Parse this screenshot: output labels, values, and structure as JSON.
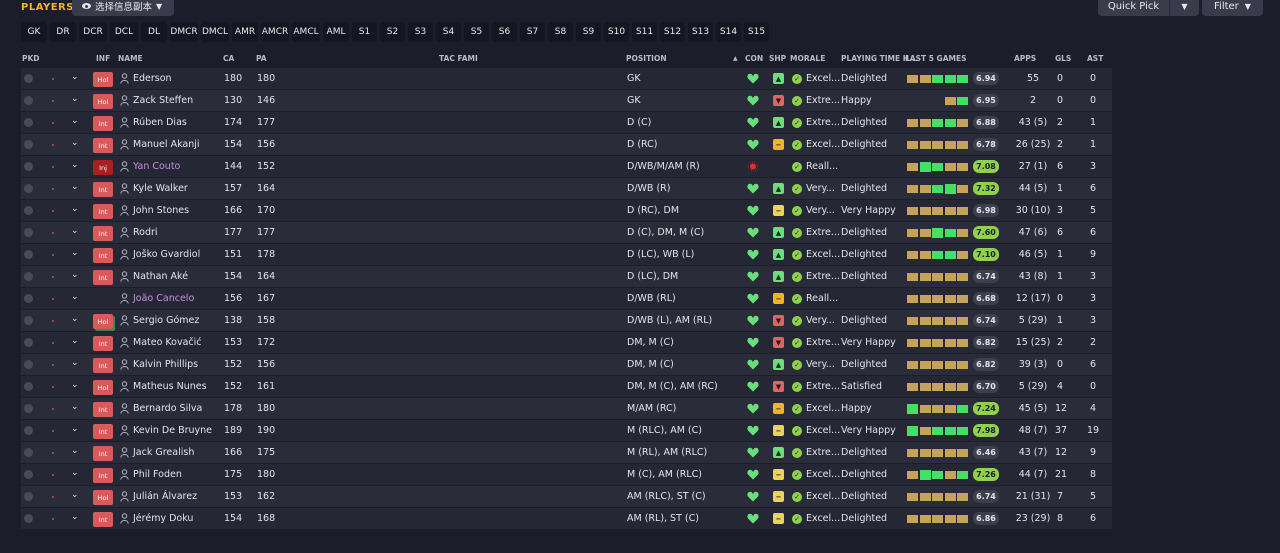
{
  "header": {
    "title": "PLAYERS",
    "view_label": "选择信息副本",
    "quick_pick_label": "Quick Pick",
    "filter_label": "Filter"
  },
  "positions": [
    "GK",
    "DR",
    "DCR",
    "DCL",
    "DL",
    "DMCR",
    "DMCL",
    "AMR",
    "AMCR",
    "AMCL",
    "AML",
    "S1",
    "S2",
    "S3",
    "S4",
    "S5",
    "S6",
    "S7",
    "S8",
    "S9",
    "S10",
    "S11",
    "S12",
    "S13",
    "S14",
    "S15"
  ],
  "columns": {
    "pkd": "PKD",
    "inf": "INF",
    "name": "NAME",
    "ca": "CA",
    "pa": "PA",
    "tac": "TAC FAMI",
    "position": "POSITION",
    "con": "CON",
    "shp": "SHP",
    "morale": "MORALE",
    "playing_time": "PLAYING TIME H...",
    "last5": "LAST 5 GAMES",
    "apps": "APPS",
    "gls": "GLS",
    "ast": "AST"
  },
  "colors": {
    "accent": "#f0b428",
    "green": "#68e07a",
    "yellow": "#e8d45a",
    "red": "#e06464",
    "orange": "#f0b428",
    "morale_green": "#8fd14f",
    "form_yellow": "#c5a35a",
    "form_green": "#44e066"
  },
  "players": [
    {
      "inf": "Hol",
      "name": "Ederson",
      "ca": "180",
      "pa": "180",
      "position": "GK",
      "con": "heart",
      "shp": "up",
      "shp_color": "green",
      "morale": "Excel...",
      "playing_time": "Delighted",
      "form": "yyggg",
      "rating": "6.94",
      "rating_style": "grey",
      "apps": "55",
      "gls": "0",
      "ast": "0"
    },
    {
      "inf": "Hol",
      "name": "Zack Steffen",
      "ca": "130",
      "pa": "146",
      "position": "GK",
      "con": "heart",
      "shp": "down",
      "shp_color": "red",
      "morale": "Extre...",
      "playing_time": "Happy",
      "form": "   yg",
      "rating": "6.95",
      "rating_style": "grey",
      "apps": "2",
      "gls": "0",
      "ast": "0"
    },
    {
      "inf": "Int",
      "name": "Rúben Dias",
      "ca": "174",
      "pa": "177",
      "position": "D (C)",
      "con": "heart",
      "shp": "up",
      "shp_color": "green",
      "morale": "Extre...",
      "playing_time": "Delighted",
      "form": "yyggy",
      "rating": "6.88",
      "rating_style": "grey",
      "apps": "43 (5)",
      "gls": "2",
      "ast": "1"
    },
    {
      "inf": "Int",
      "name": "Manuel Akanji",
      "ca": "154",
      "pa": "156",
      "position": "D (RC)",
      "con": "heart",
      "shp": "flat",
      "shp_color": "orange",
      "morale": "Excel...",
      "playing_time": "Delighted",
      "form": "yyyyy",
      "rating": "6.78",
      "rating_style": "grey",
      "apps": "26 (25)",
      "gls": "2",
      "ast": "1"
    },
    {
      "inf": "Inj",
      "name": "Yan Couto",
      "ca": "144",
      "pa": "152",
      "position": "D/WB/M/AM (R)",
      "con": "injury",
      "shp": "",
      "shp_color": "",
      "morale": "Reall...",
      "playing_time": "",
      "form": "yGgyy",
      "rating": "7.08",
      "rating_style": "green",
      "apps": "27 (1)",
      "gls": "6",
      "ast": "3"
    },
    {
      "inf": "Int",
      "name": "Kyle Walker",
      "ca": "157",
      "pa": "164",
      "position": "D/WB (R)",
      "con": "heart",
      "shp": "up",
      "shp_color": "green",
      "morale": "Very...",
      "playing_time": "Delighted",
      "form": "yygGy",
      "rating": "7.32",
      "rating_style": "green",
      "apps": "44 (5)",
      "gls": "1",
      "ast": "6"
    },
    {
      "inf": "Int",
      "name": "John Stones",
      "ca": "166",
      "pa": "170",
      "position": "D (RC), DM",
      "con": "heart",
      "shp": "flat",
      "shp_color": "yellow",
      "morale": "Very...",
      "playing_time": "Very Happy",
      "form": "yyyyy",
      "rating": "6.98",
      "rating_style": "grey",
      "apps": "30 (10)",
      "gls": "3",
      "ast": "5"
    },
    {
      "inf": "Int",
      "name": "Rodri",
      "ca": "177",
      "pa": "177",
      "position": "D (C), DM, M (C)",
      "con": "heart",
      "shp": "up",
      "shp_color": "green",
      "morale": "Extre...",
      "playing_time": "Delighted",
      "form": "yyGgy",
      "rating": "7.60",
      "rating_style": "green",
      "apps": "47 (6)",
      "gls": "6",
      "ast": "6"
    },
    {
      "inf": "Int",
      "name": "Joško Gvardiol",
      "ca": "151",
      "pa": "178",
      "position": "D (LC), WB (L)",
      "con": "heart",
      "shp": "up",
      "shp_color": "green",
      "morale": "Excel...",
      "playing_time": "Delighted",
      "form": "yyggy",
      "rating": "7.10",
      "rating_style": "green",
      "apps": "46 (5)",
      "gls": "1",
      "ast": "9"
    },
    {
      "inf": "Int",
      "name": "Nathan Aké",
      "ca": "154",
      "pa": "164",
      "position": "D (LC), DM",
      "con": "heart",
      "shp": "up",
      "shp_color": "green",
      "morale": "Extre...",
      "playing_time": "Delighted",
      "form": "yyyyy",
      "rating": "6.74",
      "rating_style": "grey",
      "apps": "43 (8)",
      "gls": "1",
      "ast": "3"
    },
    {
      "inf": "",
      "name": "João Cancelo",
      "ca": "156",
      "pa": "167",
      "position": "D/WB (RL)",
      "con": "heart",
      "shp": "flat",
      "shp_color": "orange",
      "morale": "Reall...",
      "playing_time": "",
      "form": "yyyyy",
      "rating": "6.68",
      "rating_style": "grey",
      "apps": "12 (17)",
      "gls": "0",
      "ast": "3"
    },
    {
      "inf": "Hol",
      "name": "Sergio Gómez",
      "ca": "138",
      "pa": "158",
      "position": "D/WB (L), AM (RL)",
      "con": "heart",
      "shp": "down",
      "shp_color": "red",
      "morale": "Very...",
      "playing_time": "Delighted",
      "form": "yyyyy",
      "rating": "6.74",
      "rating_style": "grey",
      "apps": "5 (29)",
      "gls": "1",
      "ast": "3"
    },
    {
      "inf": "Int",
      "name": "Mateo Kovačić",
      "ca": "153",
      "pa": "172",
      "position": "DM, M (C)",
      "con": "heart",
      "shp": "down",
      "shp_color": "red",
      "morale": "Extre...",
      "playing_time": "Very Happy",
      "form": "yyyyy",
      "rating": "6.82",
      "rating_style": "grey",
      "apps": "15 (25)",
      "gls": "2",
      "ast": "2"
    },
    {
      "inf": "Int",
      "name": "Kalvin Phillips",
      "ca": "152",
      "pa": "156",
      "position": "DM, M (C)",
      "con": "heart",
      "shp": "up",
      "shp_color": "green",
      "morale": "Very...",
      "playing_time": "Delighted",
      "form": "yyyyy",
      "rating": "6.82",
      "rating_style": "grey",
      "apps": "39 (3)",
      "gls": "0",
      "ast": "6"
    },
    {
      "inf": "Hol",
      "name": "Matheus Nunes",
      "ca": "152",
      "pa": "161",
      "position": "DM, M (C), AM (RC)",
      "con": "heart",
      "shp": "down",
      "shp_color": "red",
      "morale": "Extre...",
      "playing_time": "Satisfied",
      "form": "yyyyy",
      "rating": "6.70",
      "rating_style": "grey",
      "apps": "5 (29)",
      "gls": "4",
      "ast": "0"
    },
    {
      "inf": "Int",
      "name": "Bernardo Silva",
      "ca": "178",
      "pa": "180",
      "position": "M/AM (RC)",
      "con": "heart",
      "shp": "flat",
      "shp_color": "orange",
      "morale": "Excel...",
      "playing_time": "Happy",
      "form": "Gyyyg",
      "rating": "7.24",
      "rating_style": "green",
      "apps": "45 (5)",
      "gls": "12",
      "ast": "4"
    },
    {
      "inf": "Int",
      "name": "Kevin De Bruyne",
      "ca": "189",
      "pa": "190",
      "position": "M (RLC), AM (C)",
      "con": "heart",
      "shp": "flat",
      "shp_color": "yellow",
      "morale": "Excel...",
      "playing_time": "Very Happy",
      "form": "Gyggg",
      "rating": "7.98",
      "rating_style": "green",
      "apps": "48 (7)",
      "gls": "37",
      "ast": "19"
    },
    {
      "inf": "Int",
      "name": "Jack Grealish",
      "ca": "166",
      "pa": "175",
      "position": "M (RL), AM (RLC)",
      "con": "heart",
      "shp": "up",
      "shp_color": "green",
      "morale": "Extre...",
      "playing_time": "Delighted",
      "form": "yyyyy",
      "rating": "6.46",
      "rating_style": "grey",
      "apps": "43 (7)",
      "gls": "12",
      "ast": "9"
    },
    {
      "inf": "Int",
      "name": "Phil Foden",
      "ca": "175",
      "pa": "180",
      "position": "M (C), AM (RLC)",
      "con": "heart",
      "shp": "flat",
      "shp_color": "yellow",
      "morale": "Excel...",
      "playing_time": "Delighted",
      "form": "yGgyg",
      "rating": "7.26",
      "rating_style": "green",
      "apps": "44 (7)",
      "gls": "21",
      "ast": "8"
    },
    {
      "inf": "Hol",
      "name": "Julián Álvarez",
      "ca": "153",
      "pa": "162",
      "position": "AM (RLC), ST (C)",
      "con": "heart",
      "shp": "flat",
      "shp_color": "yellow",
      "morale": "Excel...",
      "playing_time": "Delighted",
      "form": "yyyyy",
      "rating": "6.74",
      "rating_style": "grey",
      "apps": "21 (31)",
      "gls": "7",
      "ast": "5"
    },
    {
      "inf": "Int",
      "name": "Jérémy Doku",
      "ca": "154",
      "pa": "168",
      "position": "AM (RL), ST (C)",
      "con": "heart",
      "shp": "flat",
      "shp_color": "yellow",
      "morale": "Excel...",
      "playing_time": "Delighted",
      "form": "yyyyy",
      "rating": "6.86",
      "rating_style": "grey",
      "apps": "23 (29)",
      "gls": "8",
      "ast": "6"
    }
  ]
}
